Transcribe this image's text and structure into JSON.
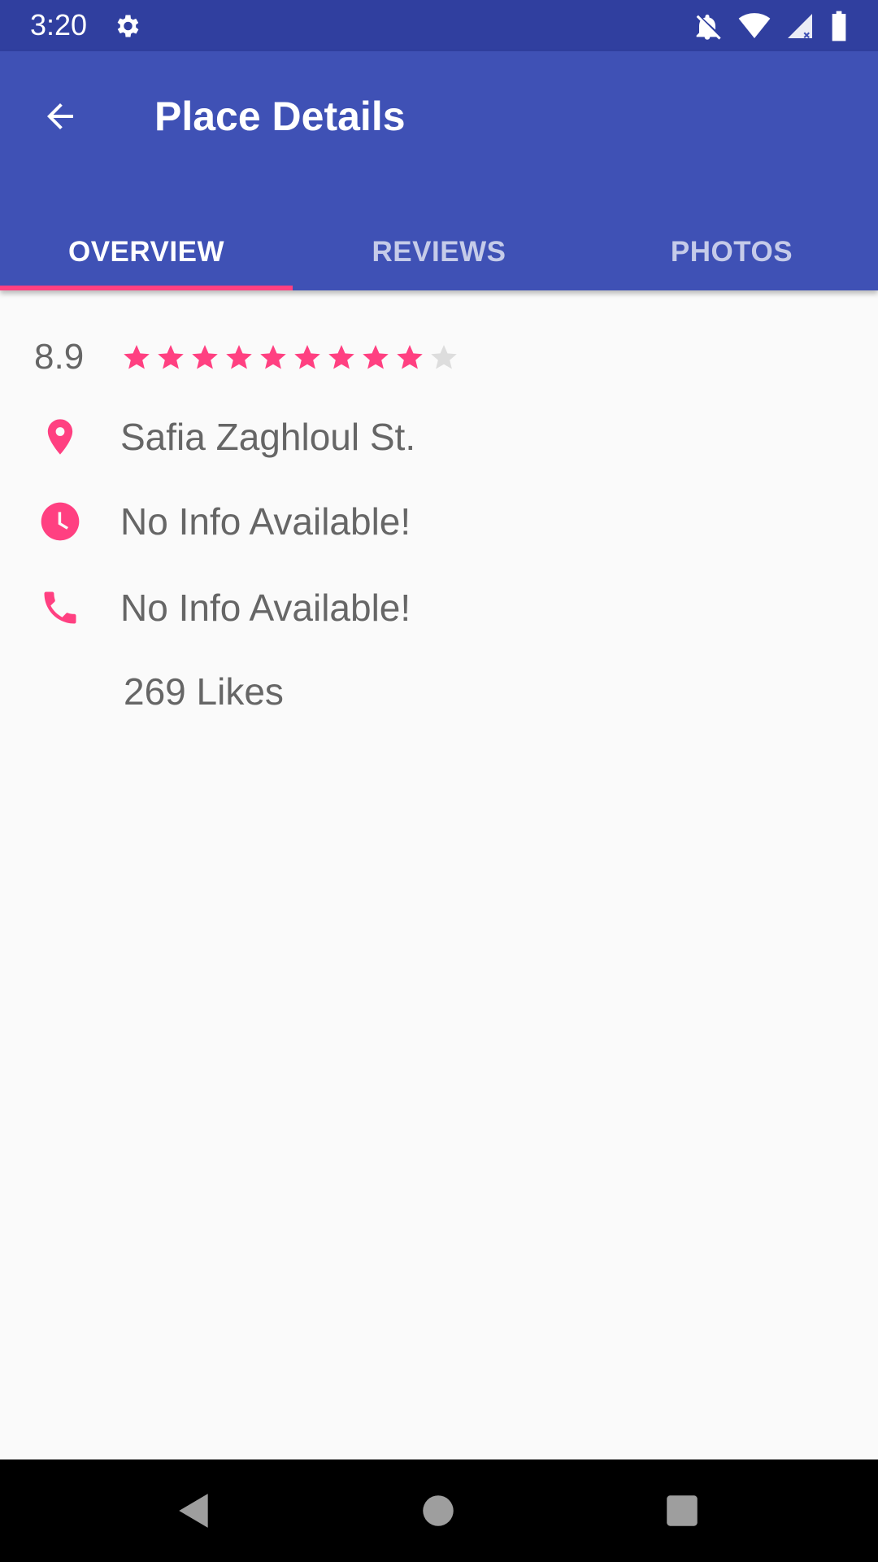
{
  "status": {
    "time": "3:20"
  },
  "app_bar": {
    "title": "Place Details"
  },
  "tabs": [
    {
      "label": "OVERVIEW",
      "active": true
    },
    {
      "label": "REVIEWS",
      "active": false
    },
    {
      "label": "PHOTOS",
      "active": false
    }
  ],
  "overview": {
    "rating": "8.9",
    "stars_total": 10,
    "stars_filled": 9,
    "address": "Safia Zaghloul St.",
    "hours": "No Info Available!",
    "phone": "No Info Available!",
    "likes": "269 Likes"
  },
  "colors": {
    "primary": "#3f51b5",
    "primary_dark": "#303f9f",
    "accent": "#ff4081",
    "text_secondary": "#666666"
  },
  "icons": {
    "status": [
      "gear-icon",
      "notifications-off-icon",
      "wifi-icon",
      "signal-icon",
      "battery-icon"
    ],
    "info": [
      "location-pin-icon",
      "clock-icon",
      "phone-icon"
    ],
    "nav": [
      "back-triangle-icon",
      "home-circle-icon",
      "recents-square-icon"
    ]
  }
}
